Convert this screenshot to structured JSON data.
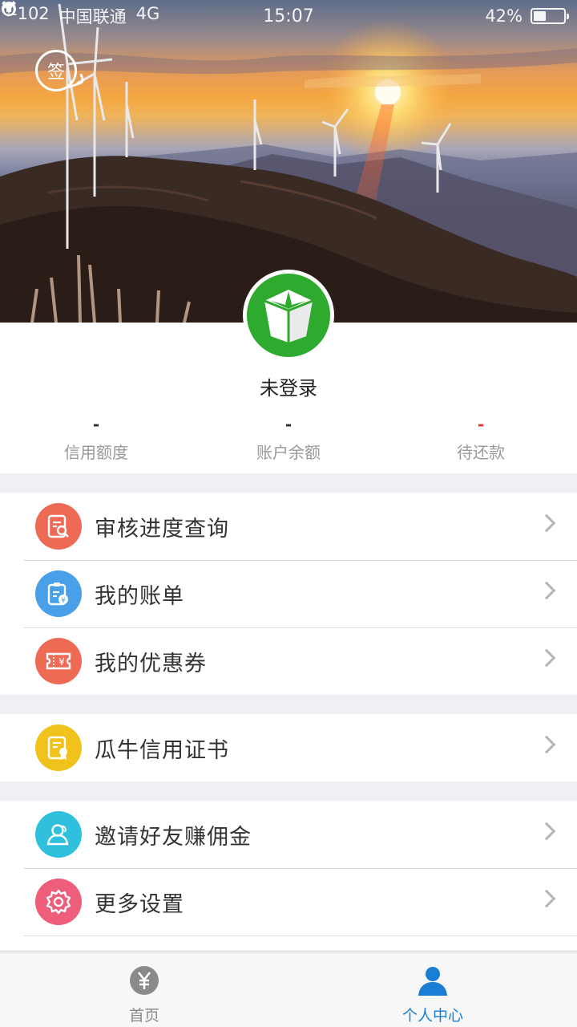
{
  "status_bar": {
    "signal": "-102",
    "carrier": "中国联通",
    "network": "4G",
    "time": "15:07",
    "battery_percent": "42%",
    "battery_level": 0.42,
    "icons": [
      "rotation-lock-icon",
      "location-icon",
      "alarm-icon"
    ]
  },
  "hero": {
    "sign_in_label": "签",
    "background": "sunset-wind-turbines-photo"
  },
  "profile": {
    "username": "未登录",
    "stats": [
      {
        "value": "-",
        "label": "信用额度"
      },
      {
        "value": "-",
        "label": "账户余额"
      },
      {
        "value": "-",
        "label": "待还款"
      }
    ]
  },
  "menu": {
    "group1": [
      {
        "label": "审核进度查询",
        "icon": "review-search-icon",
        "color": "#ee6a55"
      },
      {
        "label": "我的账单",
        "icon": "bill-icon",
        "color": "#4aa0e8"
      },
      {
        "label": "我的优惠券",
        "icon": "coupon-icon",
        "color": "#ee6a55"
      }
    ],
    "group2": [
      {
        "label": "瓜牛信用证书",
        "icon": "certificate-icon",
        "color": "#f1c21b"
      }
    ],
    "group3": [
      {
        "label": "邀请好友赚佣金",
        "icon": "invite-friends-icon",
        "color": "#2ec0dd"
      },
      {
        "label": "更多设置",
        "icon": "settings-gear-icon",
        "color": "#ee5d7a"
      }
    ]
  },
  "tabbar": {
    "tabs": [
      {
        "label": "首页",
        "icon": "yuan-icon",
        "active": false
      },
      {
        "label": "个人中心",
        "icon": "person-icon",
        "active": true
      }
    ]
  },
  "colors": {
    "accent": "#1a7fd4",
    "brand_green": "#2eaa2e",
    "negative_red": "#e23a2e"
  }
}
